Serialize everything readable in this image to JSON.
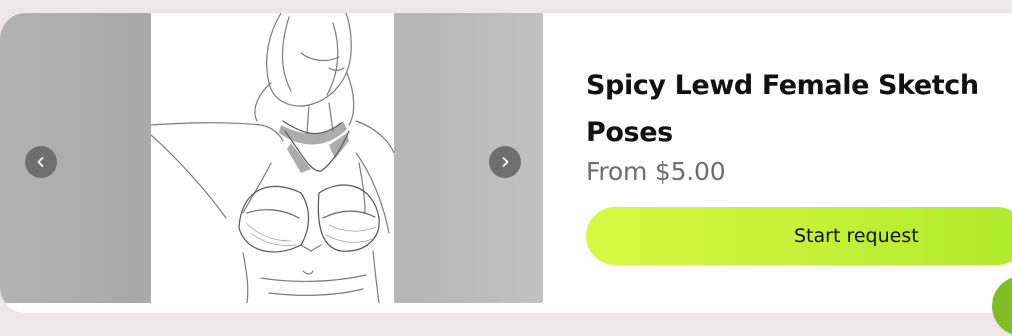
{
  "listing": {
    "title": "Spicy Lewd Female Sketch Poses",
    "price": "From $5.00",
    "cta_label": "Start request"
  },
  "carousel": {
    "prev_icon": "chevron-left-icon",
    "next_icon": "chevron-right-icon",
    "image_alt": ""
  },
  "colors": {
    "cta_start": "#d7f742",
    "cta_end": "#aeea2c",
    "nav_button": "#6f6f6f",
    "page_bg": "#efe6ea"
  }
}
